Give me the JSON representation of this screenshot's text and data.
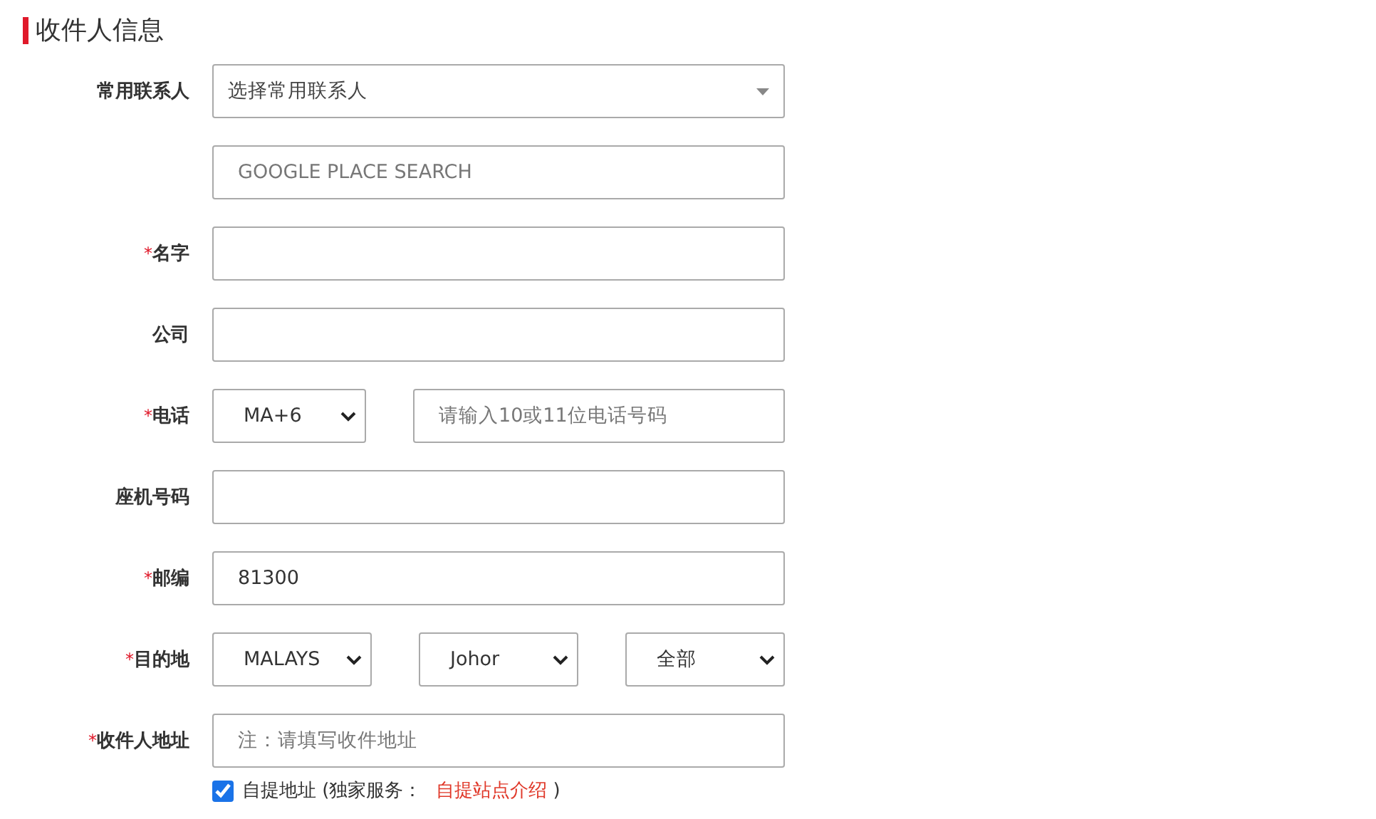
{
  "section_title": "收件人信息",
  "rows": [
    {
      "label": "常用联系人",
      "fields": [
        {
          "kind": "dropdown",
          "placeholder": "选择常用联系人"
        }
      ]
    },
    {
      "fields": [
        {
          "kind": "input",
          "placeholder": "GOOGLE PLACE SEARCH"
        }
      ]
    },
    {
      "marker": "*",
      "label": "名字",
      "fields": [
        {
          "kind": "input"
        }
      ]
    },
    {
      "label": "公司",
      "fields": [
        {
          "kind": "input"
        }
      ]
    },
    {
      "marker": "*",
      "label": "电话",
      "fields": [
        {
          "kind": "select",
          "value": "MA+6"
        },
        {
          "kind": "input",
          "placeholder": "请输入10或11位电话号码"
        }
      ]
    },
    {
      "label": "座机号码",
      "fields": [
        {
          "kind": "input"
        }
      ]
    },
    {
      "marker": "*",
      "label": "邮编",
      "fields": [
        {
          "kind": "input",
          "value": "81300"
        }
      ]
    },
    {
      "marker": "*",
      "label": "目的地",
      "fields": [
        {
          "kind": "select",
          "value": "MALAYS"
        },
        {
          "kind": "select",
          "value": "Johor"
        },
        {
          "kind": "select",
          "value": "全部"
        }
      ]
    },
    {
      "marker": "*",
      "label": "收件人地址",
      "fields": [
        {
          "kind": "input",
          "placeholder": "注：请填写收件地址"
        }
      ]
    }
  ],
  "pickup": {
    "checked": true,
    "label": "自提地址 (独家服务：",
    "link": "自提站点介绍",
    "close": ")"
  }
}
